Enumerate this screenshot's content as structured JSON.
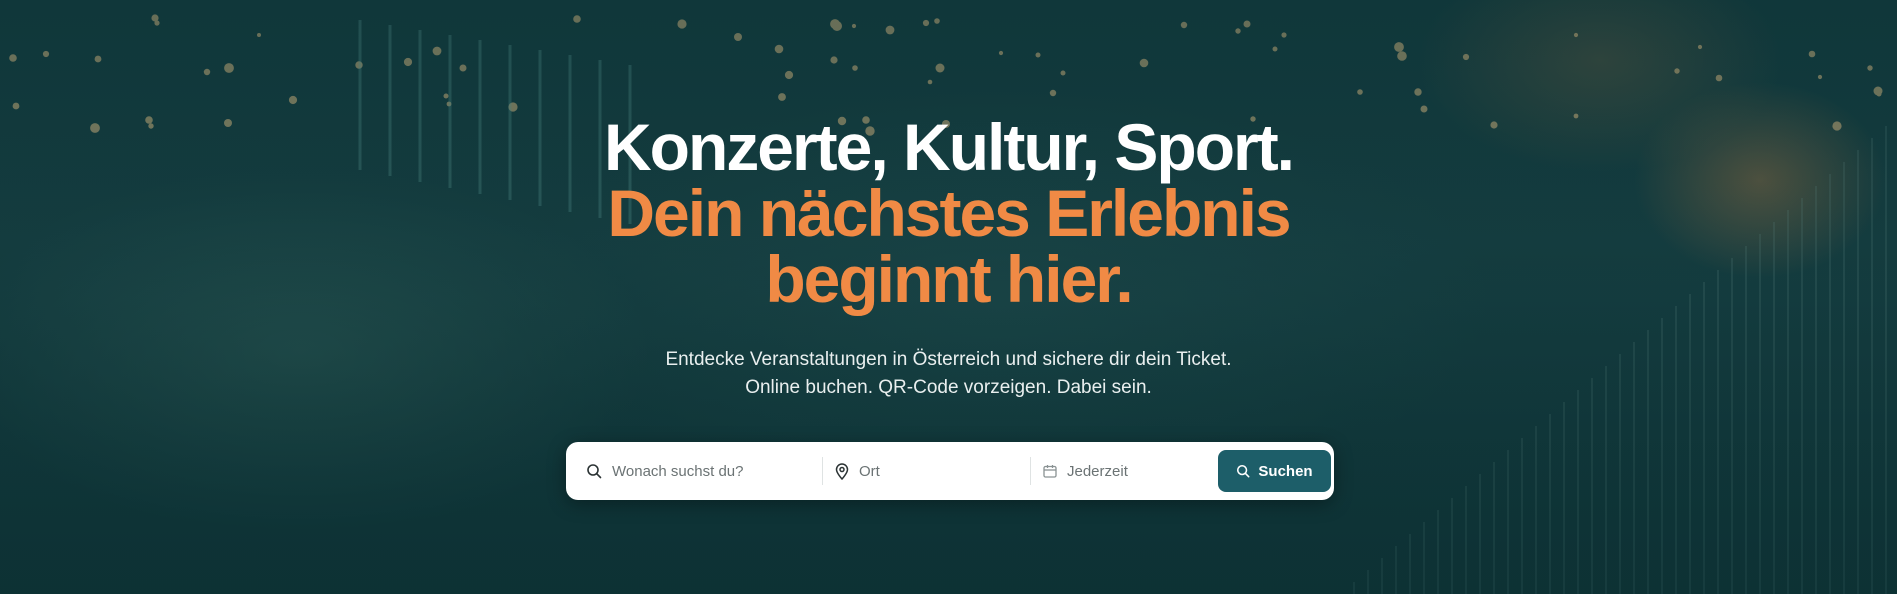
{
  "hero": {
    "title_line1": "Konzerte, Kultur, Sport.",
    "title_line2": "Dein nächstes Erlebnis",
    "title_line3": "beginnt hier.",
    "subtitle_line1": "Entdecke Veranstaltungen in Österreich und sichere dir dein Ticket.",
    "subtitle_line2": "Online buchen. QR-Code vorzeigen. Dabei sein."
  },
  "search": {
    "query_placeholder": "Wonach suchst du?",
    "location_placeholder": "Ort",
    "date_placeholder": "Jederzeit",
    "button_label": "Suchen"
  },
  "icons": {
    "query": "search-icon",
    "location": "map-pin-icon",
    "date": "calendar-icon",
    "button": "search-icon"
  },
  "colors": {
    "accent_orange": "#f08a45",
    "button_teal": "#1d5e69",
    "background_teal": "#123b3e"
  }
}
